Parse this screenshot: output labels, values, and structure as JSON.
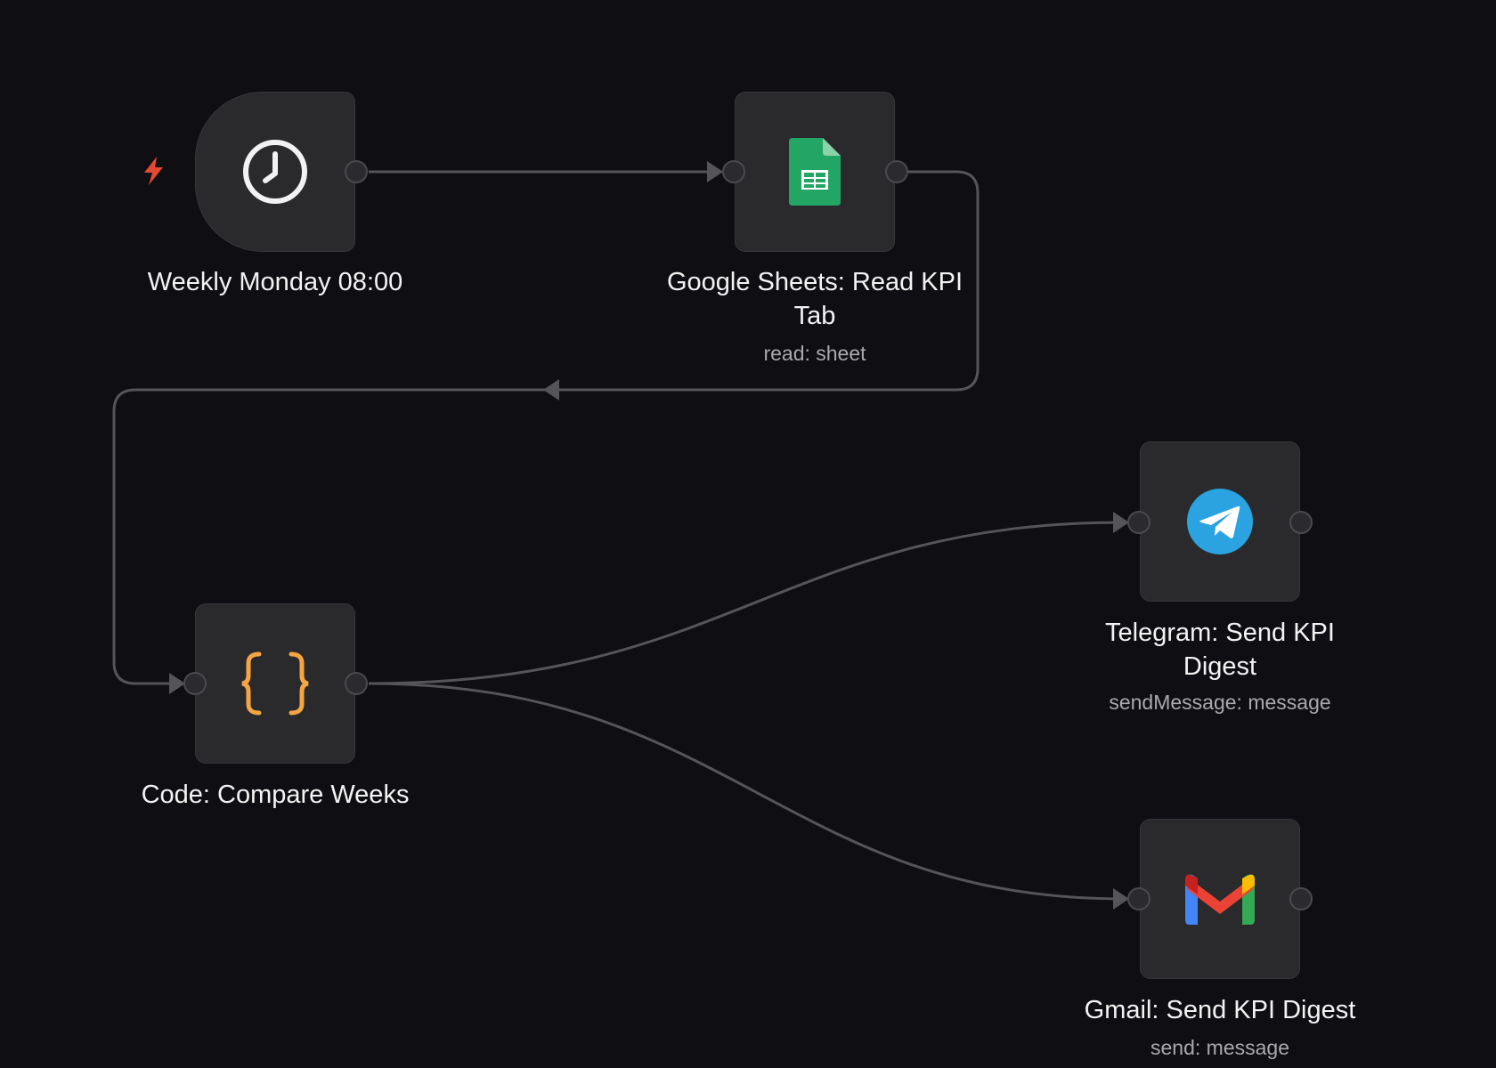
{
  "canvas": {
    "background": "#0e0e13"
  },
  "colors": {
    "edge": "#555559",
    "node_bg": "#2a2a2d",
    "trigger_bolt": "#e34a2f",
    "sheets_green": "#23a566",
    "code_orange": "#f5a544",
    "telegram_blue": "#2aa3e0"
  },
  "nodes": {
    "schedule": {
      "title": "Weekly Monday 08:00",
      "subtitle": "",
      "icon": "clock-icon",
      "trigger_icon": "lightning-bolt-icon"
    },
    "sheets": {
      "title_line1": "Google Sheets: Read KPI",
      "title_line2": "Tab",
      "subtitle": "read: sheet",
      "icon": "google-sheets-icon"
    },
    "code": {
      "title": "Code: Compare Weeks",
      "subtitle": "",
      "icon": "code-braces-icon"
    },
    "telegram": {
      "title_line1": "Telegram: Send KPI",
      "title_line2": "Digest",
      "subtitle": "sendMessage: message",
      "icon": "telegram-icon"
    },
    "gmail": {
      "title": "Gmail: Send KPI Digest",
      "subtitle": "send: message",
      "icon": "gmail-icon"
    }
  },
  "connections": [
    {
      "from": "Weekly Monday 08:00",
      "to": "Google Sheets: Read KPI Tab"
    },
    {
      "from": "Google Sheets: Read KPI Tab",
      "to": "Code: Compare Weeks"
    },
    {
      "from": "Code: Compare Weeks",
      "to": "Telegram: Send KPI Digest"
    },
    {
      "from": "Code: Compare Weeks",
      "to": "Gmail: Send KPI Digest"
    }
  ]
}
